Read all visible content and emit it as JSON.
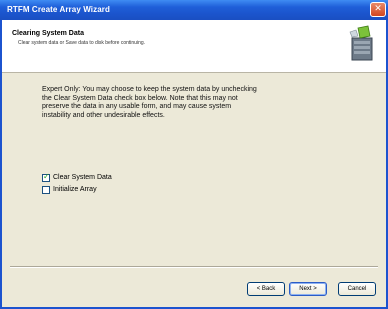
{
  "window": {
    "title": "RTFM Create Array Wizard",
    "close_glyph": "✕"
  },
  "header": {
    "title": "Clearing System Data",
    "subtitle": "Clear system data or Save data to disk before continuing.",
    "icon": "wizard-icon"
  },
  "body": {
    "lines": [
      "Expert Only: You may choose to keep the system data by unchecking",
      "the Clear System Data check box below. Note that this may not",
      "preserve the data in any usable form, and may cause system",
      "instability and other undesirable effects."
    ]
  },
  "options": {
    "clear_system_data": {
      "label": "Clear System Data",
      "checked": true
    },
    "initialize_array": {
      "label": "Initialize Array",
      "checked": false
    }
  },
  "buttons": {
    "back": "< Back",
    "next": "Next >",
    "cancel": "Cancel"
  },
  "colors": {
    "titlebar": "#1f5fd9",
    "dialog_bg": "#ece9d8",
    "header_bg": "#ffffff",
    "check_tick": "#21a121"
  }
}
